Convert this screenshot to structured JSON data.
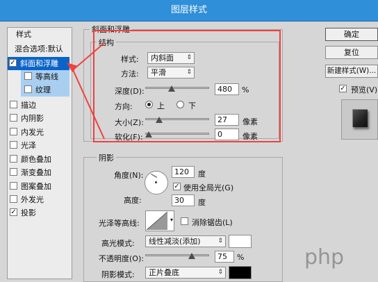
{
  "window": {
    "title": "图层样式"
  },
  "left": {
    "styles_header": "样式",
    "blend_default": "混合选项:默认",
    "items": [
      {
        "label": "斜面和浮雕",
        "checked": true
      },
      {
        "label": "等高线",
        "checked": false
      },
      {
        "label": "纹理",
        "checked": false
      },
      {
        "label": "描边",
        "checked": false
      },
      {
        "label": "内阴影",
        "checked": false
      },
      {
        "label": "内发光",
        "checked": false
      },
      {
        "label": "光泽",
        "checked": false
      },
      {
        "label": "颜色叠加",
        "checked": false
      },
      {
        "label": "渐变叠加",
        "checked": false
      },
      {
        "label": "图案叠加",
        "checked": false
      },
      {
        "label": "外发光",
        "checked": false
      },
      {
        "label": "投影",
        "checked": true
      }
    ]
  },
  "bevel": {
    "group_title": "斜面和浮雕",
    "structure_title": "结构",
    "style_label": "样式:",
    "style_value": "内斜面",
    "method_label": "方法:",
    "method_value": "平滑",
    "depth_label": "深度(D):",
    "depth_value": "480",
    "depth_unit": "%",
    "depth_fraction": 0.4,
    "direction_label": "方向:",
    "direction_up": "上",
    "direction_down": "下",
    "direction_selected": "上",
    "size_label": "大小(Z):",
    "size_value": "27",
    "size_unit": "像素",
    "size_fraction": 0.18,
    "soften_label": "软化(F):",
    "soften_value": "0",
    "soften_unit": "像素",
    "soften_fraction": 0.0
  },
  "shading": {
    "group_title": "阴影",
    "angle_label": "角度(N):",
    "angle_value": "120",
    "angle_unit": "度",
    "global_light_label": "使用全局光(G)",
    "global_light_checked": true,
    "altitude_label": "高度:",
    "altitude_value": "30",
    "altitude_unit": "度",
    "gloss_contour_label": "光泽等高线:",
    "antialias_label": "消除锯齿(L)",
    "highlight_mode_label": "高光模式:",
    "highlight_mode_value": "线性减淡(添加)",
    "highlight_color": "#ffffff",
    "opacity_label": "不透明度(O):",
    "opacity_value": "75",
    "opacity_unit": "%",
    "opacity_fraction": 0.75,
    "shadow_mode_label": "阴影模式:",
    "shadow_mode_value": "正片叠底",
    "shadow_color": "#000000"
  },
  "buttons": {
    "ok": "确定",
    "reset": "复位",
    "new_style": "新建样式(W)...",
    "preview_label": "预览(V)",
    "preview_checked": true
  },
  "accent": {
    "selection": "#0a64c8",
    "annotation": "#f04040"
  },
  "watermark": "php"
}
